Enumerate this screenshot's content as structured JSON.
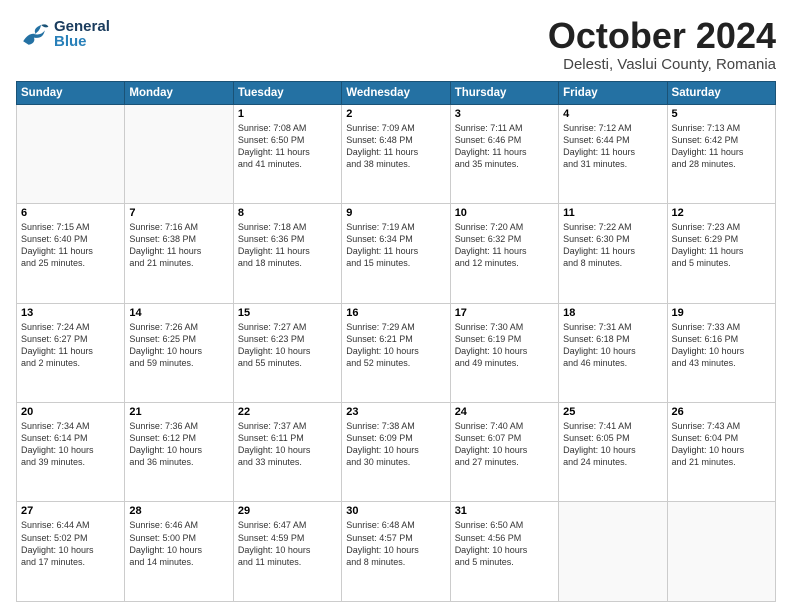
{
  "header": {
    "logo_general": "General",
    "logo_blue": "Blue",
    "title": "October 2024",
    "location": "Delesti, Vaslui County, Romania"
  },
  "days_header": [
    "Sunday",
    "Monday",
    "Tuesday",
    "Wednesday",
    "Thursday",
    "Friday",
    "Saturday"
  ],
  "weeks": [
    [
      {
        "day": "",
        "info": ""
      },
      {
        "day": "",
        "info": ""
      },
      {
        "day": "1",
        "info": "Sunrise: 7:08 AM\nSunset: 6:50 PM\nDaylight: 11 hours\nand 41 minutes."
      },
      {
        "day": "2",
        "info": "Sunrise: 7:09 AM\nSunset: 6:48 PM\nDaylight: 11 hours\nand 38 minutes."
      },
      {
        "day": "3",
        "info": "Sunrise: 7:11 AM\nSunset: 6:46 PM\nDaylight: 11 hours\nand 35 minutes."
      },
      {
        "day": "4",
        "info": "Sunrise: 7:12 AM\nSunset: 6:44 PM\nDaylight: 11 hours\nand 31 minutes."
      },
      {
        "day": "5",
        "info": "Sunrise: 7:13 AM\nSunset: 6:42 PM\nDaylight: 11 hours\nand 28 minutes."
      }
    ],
    [
      {
        "day": "6",
        "info": "Sunrise: 7:15 AM\nSunset: 6:40 PM\nDaylight: 11 hours\nand 25 minutes."
      },
      {
        "day": "7",
        "info": "Sunrise: 7:16 AM\nSunset: 6:38 PM\nDaylight: 11 hours\nand 21 minutes."
      },
      {
        "day": "8",
        "info": "Sunrise: 7:18 AM\nSunset: 6:36 PM\nDaylight: 11 hours\nand 18 minutes."
      },
      {
        "day": "9",
        "info": "Sunrise: 7:19 AM\nSunset: 6:34 PM\nDaylight: 11 hours\nand 15 minutes."
      },
      {
        "day": "10",
        "info": "Sunrise: 7:20 AM\nSunset: 6:32 PM\nDaylight: 11 hours\nand 12 minutes."
      },
      {
        "day": "11",
        "info": "Sunrise: 7:22 AM\nSunset: 6:30 PM\nDaylight: 11 hours\nand 8 minutes."
      },
      {
        "day": "12",
        "info": "Sunrise: 7:23 AM\nSunset: 6:29 PM\nDaylight: 11 hours\nand 5 minutes."
      }
    ],
    [
      {
        "day": "13",
        "info": "Sunrise: 7:24 AM\nSunset: 6:27 PM\nDaylight: 11 hours\nand 2 minutes."
      },
      {
        "day": "14",
        "info": "Sunrise: 7:26 AM\nSunset: 6:25 PM\nDaylight: 10 hours\nand 59 minutes."
      },
      {
        "day": "15",
        "info": "Sunrise: 7:27 AM\nSunset: 6:23 PM\nDaylight: 10 hours\nand 55 minutes."
      },
      {
        "day": "16",
        "info": "Sunrise: 7:29 AM\nSunset: 6:21 PM\nDaylight: 10 hours\nand 52 minutes."
      },
      {
        "day": "17",
        "info": "Sunrise: 7:30 AM\nSunset: 6:19 PM\nDaylight: 10 hours\nand 49 minutes."
      },
      {
        "day": "18",
        "info": "Sunrise: 7:31 AM\nSunset: 6:18 PM\nDaylight: 10 hours\nand 46 minutes."
      },
      {
        "day": "19",
        "info": "Sunrise: 7:33 AM\nSunset: 6:16 PM\nDaylight: 10 hours\nand 43 minutes."
      }
    ],
    [
      {
        "day": "20",
        "info": "Sunrise: 7:34 AM\nSunset: 6:14 PM\nDaylight: 10 hours\nand 39 minutes."
      },
      {
        "day": "21",
        "info": "Sunrise: 7:36 AM\nSunset: 6:12 PM\nDaylight: 10 hours\nand 36 minutes."
      },
      {
        "day": "22",
        "info": "Sunrise: 7:37 AM\nSunset: 6:11 PM\nDaylight: 10 hours\nand 33 minutes."
      },
      {
        "day": "23",
        "info": "Sunrise: 7:38 AM\nSunset: 6:09 PM\nDaylight: 10 hours\nand 30 minutes."
      },
      {
        "day": "24",
        "info": "Sunrise: 7:40 AM\nSunset: 6:07 PM\nDaylight: 10 hours\nand 27 minutes."
      },
      {
        "day": "25",
        "info": "Sunrise: 7:41 AM\nSunset: 6:05 PM\nDaylight: 10 hours\nand 24 minutes."
      },
      {
        "day": "26",
        "info": "Sunrise: 7:43 AM\nSunset: 6:04 PM\nDaylight: 10 hours\nand 21 minutes."
      }
    ],
    [
      {
        "day": "27",
        "info": "Sunrise: 6:44 AM\nSunset: 5:02 PM\nDaylight: 10 hours\nand 17 minutes."
      },
      {
        "day": "28",
        "info": "Sunrise: 6:46 AM\nSunset: 5:00 PM\nDaylight: 10 hours\nand 14 minutes."
      },
      {
        "day": "29",
        "info": "Sunrise: 6:47 AM\nSunset: 4:59 PM\nDaylight: 10 hours\nand 11 minutes."
      },
      {
        "day": "30",
        "info": "Sunrise: 6:48 AM\nSunset: 4:57 PM\nDaylight: 10 hours\nand 8 minutes."
      },
      {
        "day": "31",
        "info": "Sunrise: 6:50 AM\nSunset: 4:56 PM\nDaylight: 10 hours\nand 5 minutes."
      },
      {
        "day": "",
        "info": ""
      },
      {
        "day": "",
        "info": ""
      }
    ]
  ]
}
